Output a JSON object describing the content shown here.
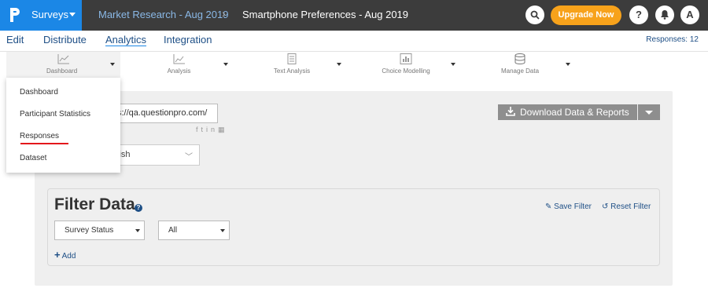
{
  "topbar": {
    "product_label": "Surveys",
    "breadcrumb_parent": "Market Research - Aug 2019",
    "breadcrumb_current": "Smartphone Preferences - Aug 2019",
    "upgrade_label": "Upgrade Now",
    "help_label": "?",
    "avatar_initial": "A",
    "colors": {
      "brand": "#1b87e6",
      "upgrade": "#f7a21b",
      "bar": "#3c3c3c"
    }
  },
  "nav": {
    "items": [
      {
        "label": "Edit"
      },
      {
        "label": "Distribute"
      },
      {
        "label": "Analytics"
      },
      {
        "label": "Integration"
      }
    ],
    "active": "Analytics",
    "responses_count": "Responses: 12"
  },
  "subnav": {
    "items": [
      {
        "label": "Dashboard",
        "icon": "line-chart-icon"
      },
      {
        "label": "Analysis",
        "icon": "chart-icon"
      },
      {
        "label": "Text Analysis",
        "icon": "document-icon"
      },
      {
        "label": "Choice Modelling",
        "icon": "bar-chart-icon"
      },
      {
        "label": "Manage Data",
        "icon": "database-icon"
      }
    ]
  },
  "dropdown": {
    "items": [
      {
        "label": "Dashboard"
      },
      {
        "label": "Participant Statistics"
      },
      {
        "label": "Responses"
      },
      {
        "label": "Dataset"
      }
    ],
    "highlighted": "Responses"
  },
  "main": {
    "survey_url": "s://qa.questionpro.com/",
    "share_icons": [
      "facebook-icon",
      "twitter-icon",
      "linkedin-icon",
      "qr-code-icon"
    ],
    "language_value": "lish",
    "download_label": "Download Data & Reports"
  },
  "filter": {
    "title": "Filter Data",
    "save_label": "Save Filter",
    "reset_label": "Reset Filter",
    "status_select": "Survey Status",
    "value_select": "All",
    "add_label": "Add"
  }
}
